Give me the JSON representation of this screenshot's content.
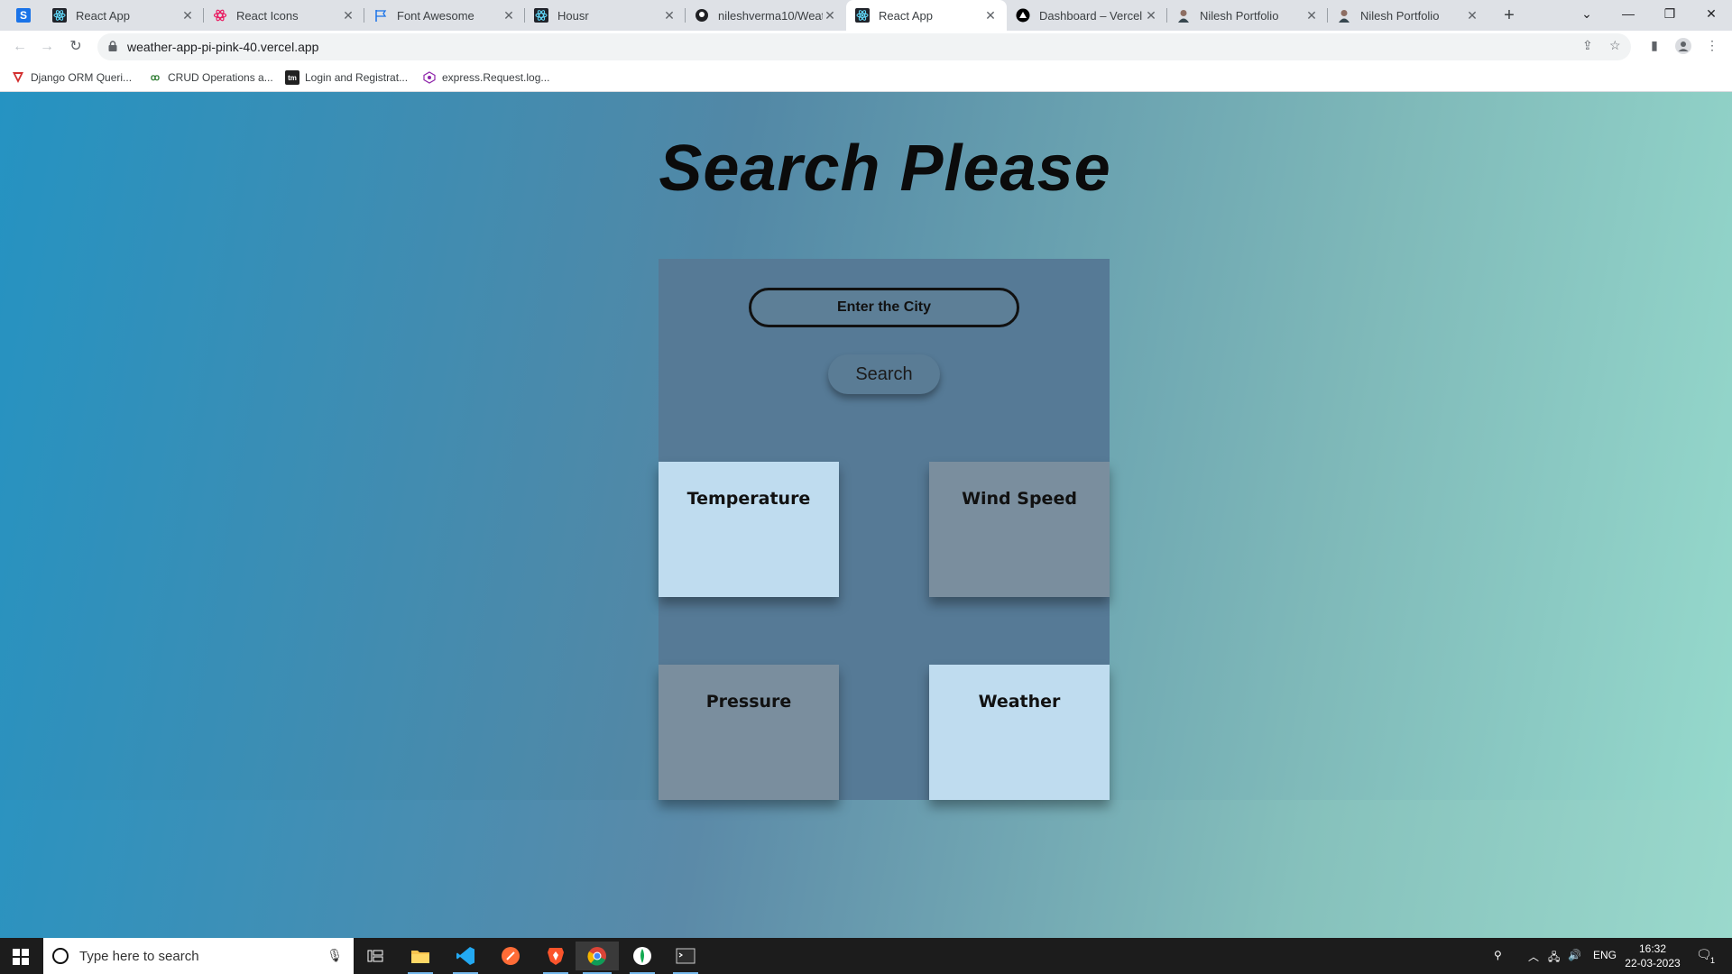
{
  "browser": {
    "tabs": [
      {
        "label": "",
        "icon": "s-app-icon",
        "color": "#1a73e8"
      },
      {
        "label": "React App",
        "icon": "react-icon",
        "color": "#61dafb"
      },
      {
        "label": "React Icons",
        "icon": "react-icons-icon",
        "color": "#e91e63"
      },
      {
        "label": "Font Awesome",
        "icon": "flag-icon",
        "color": "#1a73e8"
      },
      {
        "label": "Housr",
        "icon": "react-icon",
        "color": "#61dafb"
      },
      {
        "label": "nileshverma10/Weat",
        "icon": "github-icon",
        "color": "#202124"
      },
      {
        "label": "React App",
        "icon": "react-icon",
        "color": "#61dafb",
        "active": true
      },
      {
        "label": "Dashboard – Vercel",
        "icon": "vercel-icon",
        "color": "#000000"
      },
      {
        "label": "Nilesh Portfolio",
        "icon": "avatar-icon",
        "color": "#8d6e63"
      },
      {
        "label": "Nilesh Portfolio",
        "icon": "avatar-icon",
        "color": "#8d6e63"
      }
    ],
    "new_tab_label": "+",
    "url": "weather-app-pi-pink-40.vercel.app",
    "bookmarks": [
      {
        "label": "Django ORM Queri...",
        "icon": "django-icon",
        "color": "#d32f2f"
      },
      {
        "label": "CRUD Operations a...",
        "icon": "crud-icon",
        "color": "#2e7d32"
      },
      {
        "label": "Login and Registrat...",
        "icon": "tm-icon",
        "color": "#212121"
      },
      {
        "label": "express.Request.log...",
        "icon": "express-icon",
        "color": "#8e24aa"
      }
    ]
  },
  "page": {
    "title": "Search Please",
    "input_placeholder": "Enter the City",
    "search_button": "Search",
    "tiles": [
      {
        "label": "Temperature",
        "style": "light"
      },
      {
        "label": "Wind Speed",
        "style": "dark"
      },
      {
        "label": "Pressure",
        "style": "dark"
      },
      {
        "label": "Weather",
        "style": "light"
      }
    ],
    "colors": {
      "card": "#567a96",
      "tile_light": "#bfdcef",
      "tile_dark": "#7a8e9e"
    }
  },
  "taskbar": {
    "search_placeholder": "Type here to search",
    "language": "ENG",
    "time": "16:32",
    "date": "22-03-2023",
    "notification_count": "1"
  }
}
